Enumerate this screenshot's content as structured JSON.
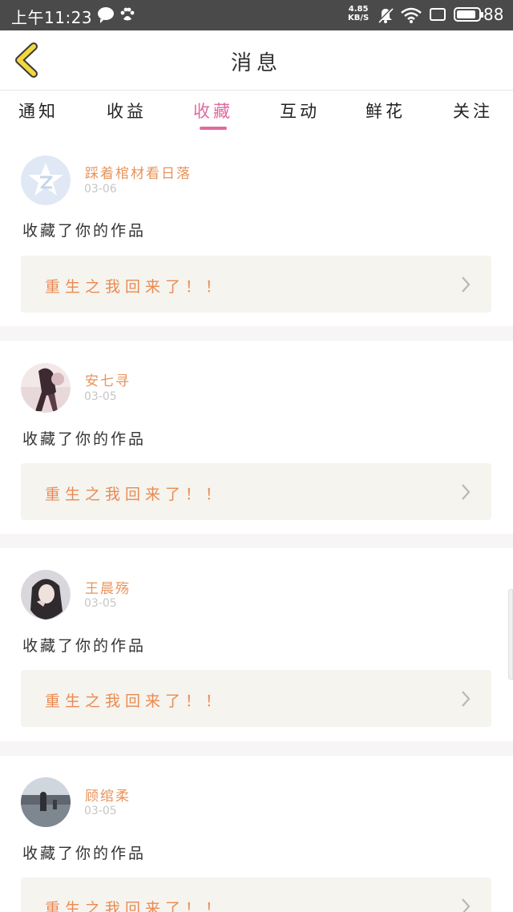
{
  "status_bar": {
    "time": "上午11:23",
    "net_speed_value": "4.85",
    "net_speed_unit": "KB/S",
    "battery_level": "88",
    "battery_fraction": 0.88
  },
  "header": {
    "title": "消息",
    "back_icon": "chevron-left-icon"
  },
  "tabs": [
    {
      "label": "通知",
      "active": false
    },
    {
      "label": "收益",
      "active": false
    },
    {
      "label": "收藏",
      "active": true
    },
    {
      "label": "互动",
      "active": false
    },
    {
      "label": "鲜花",
      "active": false
    },
    {
      "label": "关注",
      "active": false
    }
  ],
  "messages": [
    {
      "username": "踩着棺材看日落",
      "date": "03-06",
      "action": "收藏了你的作品",
      "work_title": "重生之我回来了！！",
      "avatar": "qzone-default-avatar"
    },
    {
      "username": "安七寻",
      "date": "03-05",
      "action": "收藏了你的作品",
      "work_title": "重生之我回来了！！",
      "avatar": "photo-avatar"
    },
    {
      "username": "王晨殇",
      "date": "03-05",
      "action": "收藏了你的作品",
      "work_title": "重生之我回来了！！",
      "avatar": "photo-avatar"
    },
    {
      "username": "顾绾柔",
      "date": "03-05",
      "action": "收藏了你的作品",
      "work_title": "重生之我回来了！！",
      "avatar": "photo-avatar"
    }
  ],
  "colors": {
    "accent_pink": "#e06aa0",
    "username_orange": "#e8935a",
    "work_title_orange": "#eb8a52",
    "back_arrow_yellow": "#f2d83c",
    "work_box_bg": "#f5f4ef",
    "status_bar_bg": "#4a4a4a"
  }
}
